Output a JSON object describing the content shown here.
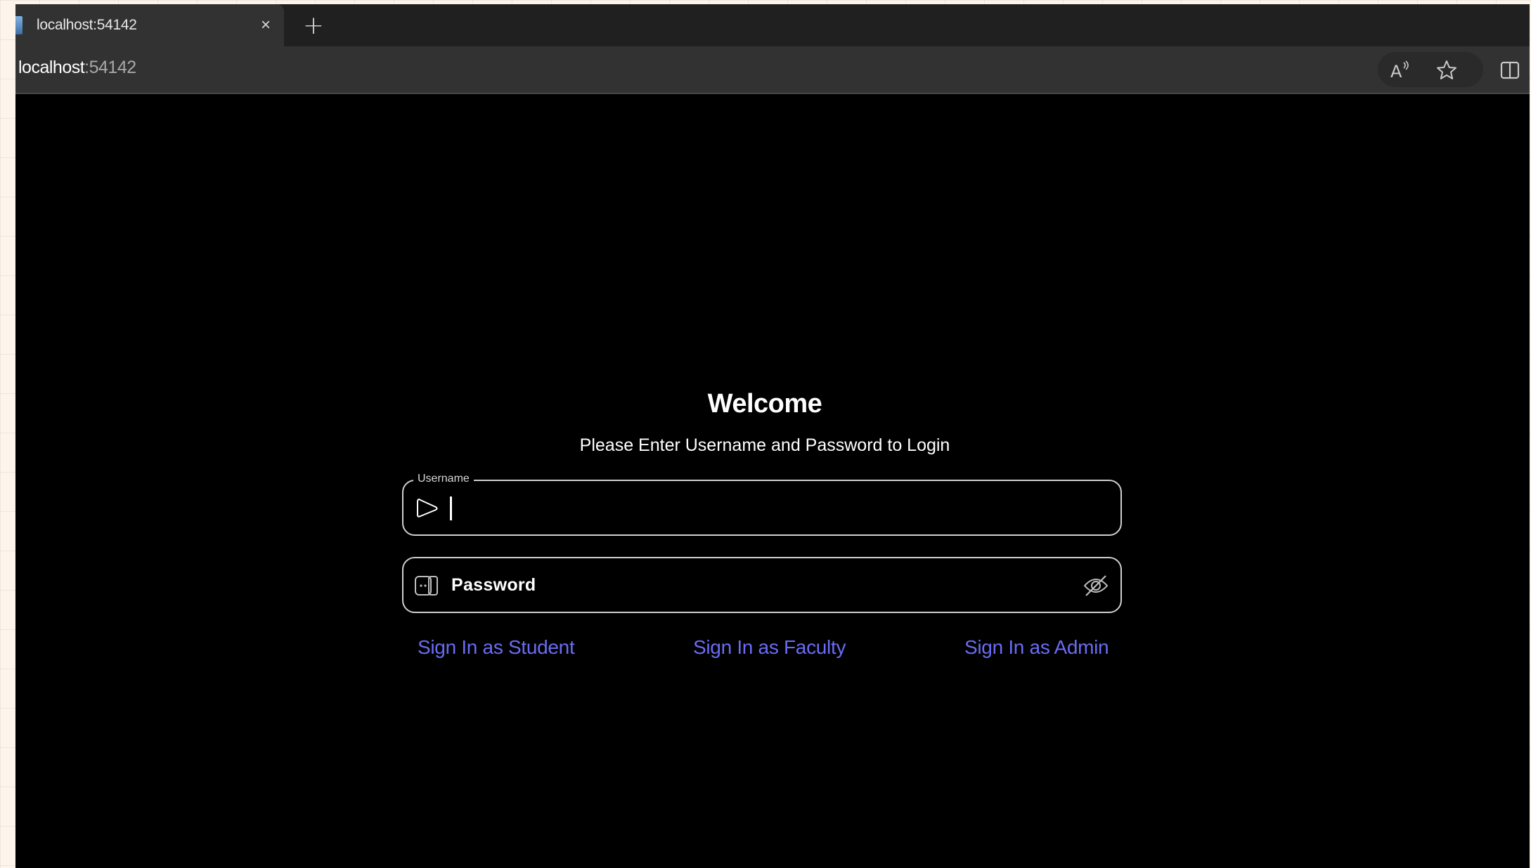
{
  "browser": {
    "tab_title": "localhost:54142",
    "close_glyph": "×",
    "new_tab_glyph": "+",
    "address_host": "localhost",
    "address_port": ":54142",
    "icons": [
      "read-aloud-icon",
      "favorite-star-icon",
      "split-screen-icon"
    ]
  },
  "login": {
    "title": "Welcome",
    "subtitle": "Please Enter Username and Password to Login",
    "username_label": "Username",
    "username_value": "",
    "password_placeholder": "Password",
    "links": {
      "student": "Sign In as Student",
      "faculty": "Sign In as Faculty",
      "admin": "Sign In as Admin"
    },
    "link_color": "#6a6cf4"
  }
}
